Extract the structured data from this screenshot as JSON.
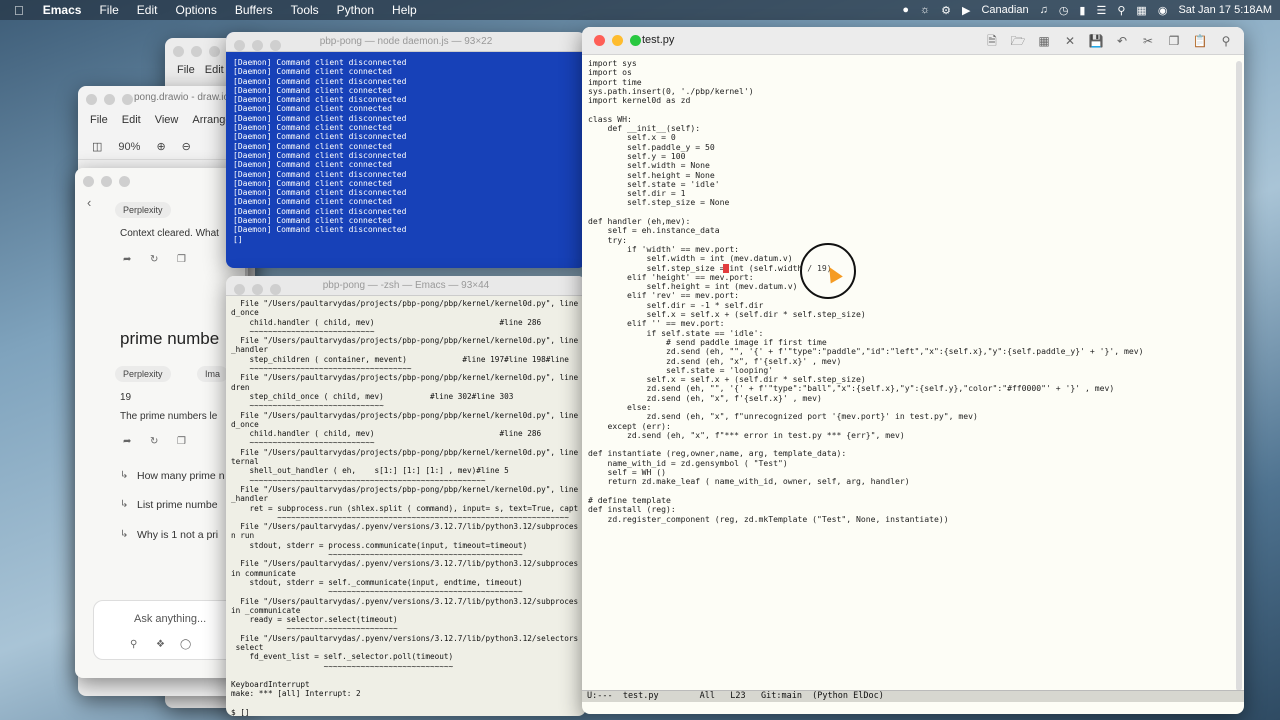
{
  "menubar": {
    "apple": "",
    "app": "Emacs",
    "items": [
      "File",
      "Edit",
      "Options",
      "Buffers",
      "Tools",
      "Python",
      "Help"
    ],
    "right": {
      "input_source": "Canadian",
      "datetime": "Sat Jan 17  5:18AM"
    }
  },
  "drawio": {
    "title": "pong.drawio - draw.io",
    "menu": [
      "File",
      "Edit",
      "View",
      "Arrange"
    ],
    "zoom": "90%"
  },
  "back_editor": {
    "menu": [
      "File",
      "Edit"
    ]
  },
  "perplexity": {
    "badge1": "Perplexity",
    "context_text": "Context cleared. What",
    "heading": "prime numbe",
    "badge2": "Perplexity",
    "badge3": "Ima",
    "answer": "19",
    "answer_text": "The prime numbers le",
    "related": [
      "How many prime n",
      "List prime numbe",
      "Why is 1 not a pri"
    ],
    "ask_placeholder": "Ask anything..."
  },
  "daemon": {
    "title": "pbp-pong — node daemon.js — 93×22",
    "lines": [
      "[Daemon] Command client disconnected",
      "[Daemon] Command client connected",
      "[Daemon] Command client disconnected",
      "[Daemon] Command client connected",
      "[Daemon] Command client disconnected",
      "[Daemon] Command client connected",
      "[Daemon] Command client disconnected",
      "[Daemon] Command client connected",
      "[Daemon] Command client disconnected",
      "[Daemon] Command client connected",
      "[Daemon] Command client disconnected",
      "[Daemon] Command client connected",
      "[Daemon] Command client disconnected",
      "[Daemon] Command client connected",
      "[Daemon] Command client disconnected",
      "[Daemon] Command client connected",
      "[Daemon] Command client disconnected",
      "[Daemon] Command client connected",
      "[Daemon] Command client disconnected",
      "[]"
    ]
  },
  "zsh": {
    "title": "pbp-pong — -zsh — Emacs — 93×44",
    "text": "  File \"/Users/paultarvydas/projects/pbp-pong/pbp/kernel/kernel0d.py\", line\nd_once\n    child.handler ( child, mev)                           #line 286\n    ~~~~~~~~~~~~~~~~~~~~~~~~~~~\n  File \"/Users/paultarvydas/projects/pbp-pong/pbp/kernel/kernel0d.py\", line\n_handler\n    step_children ( container, mevent)            #line 197#line 198#line\n    ~~~~~~~~~~~~~~~~~~~~~~~~~~~~~~~~~~~\n  File \"/Users/paultarvydas/projects/pbp-pong/pbp/kernel/kernel0d.py\", line\ndren\n    step_child_once ( child, mev)          #line 302#line 303\n    ~~~~~~~~~~~~~~~~~~~~~~~~~~~~~\n  File \"/Users/paultarvydas/projects/pbp-pong/pbp/kernel/kernel0d.py\", line\nd_once\n    child.handler ( child, mev)                           #line 286\n    ~~~~~~~~~~~~~~~~~~~~~~~~~~~\n  File \"/Users/paultarvydas/projects/pbp-pong/pbp/kernel/kernel0d.py\", line\nternal\n    shell_out_handler ( eh,    s[1:] [1:] [1:] , mev)#line 5\n    ~~~~~~~~~~~~~~~~~~~~~~~~~~~~~~~~~~~~~~~~~~~~~~~~~~~\n  File \"/Users/paultarvydas/projects/pbp-pong/pbp/kernel/kernel0d.py\", line\n_handler\n    ret = subprocess.run (shlex.split ( command), input= s, text=True, capt\n          ~~~~~~~~~~~~~~~~~~~~~~~~~~~~~~~~~~~~~~~~~~~~~~~~~~~~~~~~~~~~~~~\n  File \"/Users/paultarvydas/.pyenv/versions/3.12.7/lib/python3.12/subproces\nn run\n    stdout, stderr = process.communicate(input, timeout=timeout)\n                     ~~~~~~~~~~~~~~~~~~~~~~~~~~~~~~~~~~~~~~~~~~\n  File \"/Users/paultarvydas/.pyenv/versions/3.12.7/lib/python3.12/subproces\nin communicate\n    stdout, stderr = self._communicate(input, endtime, timeout)\n                     ~~~~~~~~~~~~~~~~~~~~~~~~~~~~~~~~~~~~~~~~~~\n  File \"/Users/paultarvydas/.pyenv/versions/3.12.7/lib/python3.12/subproces\nin _communicate\n    ready = selector.select(timeout)\n            ~~~~~~~~~~~~~~~~~~~~~~~~\n  File \"/Users/paultarvydas/.pyenv/versions/3.12.7/lib/python3.12/selectors\n select\n    fd_event_list = self._selector.poll(timeout)\n                    ~~~~~~~~~~~~~~~~~~~~~~~~~~~~\n\nKeyboardInterrupt\nmake: *** [all] Interrupt: 2\n\n$ []"
  },
  "emacs": {
    "title": "test.py",
    "code": "import sys\nimport os\nimport time\nsys.path.insert(0, './pbp/kernel')\nimport kernel0d as zd\n\nclass WH:\n    def __init__(self):\n        self.x = 0\n        self.paddle_y = 50\n        self.y = 100\n        self.width = None\n        self.height = None\n        self.state = 'idle'\n        self.dir = 1\n        self.step_size = None\n\ndef handler (eh,mev):\n    self = eh.instance_data\n    try:\n        if 'width' == mev.port:\n            self.width = int (mev.datum.v)\n            self.step_size = int (self.width / 19)\n        elif 'height' == mev.port:\n            self.height = int (mev.datum.v)\n        elif 'rev' == mev.port:\n            self.dir = -1 * self.dir\n            self.x = self.x + (self.dir * self.step_size)\n        elif '' == mev.port:\n            if self.state == 'idle':\n                # send paddle image if first time\n                zd.send (eh, \"\", '{' + f'\"type\":\"paddle\",\"id\":\"left\",\"x\":{self.x},\"y\":{self.paddle_y}' + '}', mev)\n                zd.send (eh, \"x\", f'{self.x}' , mev)\n                self.state = 'looping'\n            self.x = self.x + (self.dir * self.step_size)\n            zd.send (eh, \"\", '{' + f'\"type\":\"ball\",\"x\":{self.x},\"y\":{self.y},\"color\":\"#ff0000\"' + '}' , mev)\n            zd.send (eh, \"x\", f'{self.x}' , mev)\n        else:\n            zd.send (eh, \"x\", f\"unrecognized port '{mev.port}' in test.py\", mev)\n    except (err):\n        zd.send (eh, \"x\", f\"*** error in test.py *** {err}\", mev)\n\ndef instantiate (reg,owner,name, arg, template_data):\n    name_with_id = zd.gensymbol ( \"Test\")\n    self = WH ()\n    return zd.make_leaf ( name_with_id, owner, self, arg, handler)\n\n# define template\ndef install (reg):\n    zd.register_component (reg, zd.mkTemplate (\"Test\", None, instantiate))",
    "modeline": "U:---  test.py        All   L23   Git:main  (Python ElDoc)"
  }
}
